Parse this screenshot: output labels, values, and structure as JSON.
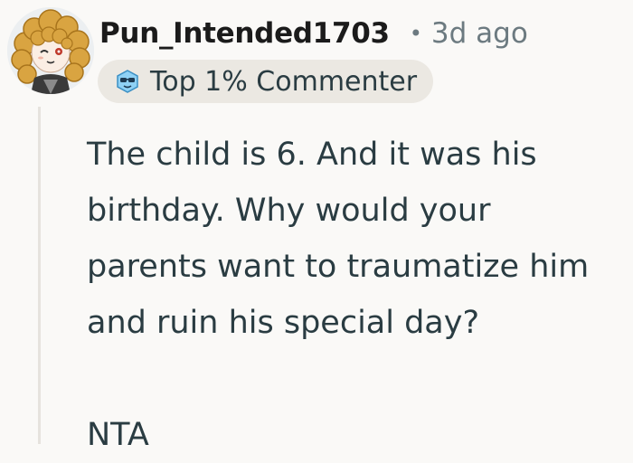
{
  "comment": {
    "username": "Pun_Intended1703",
    "separator": "•",
    "timestamp": "3d ago",
    "badge": {
      "icon": "sunglasses-face-icon",
      "label": "Top 1% Commenter"
    },
    "body_lines": [
      "The child is 6. And it was his",
      "birthday. Why would your",
      "parents want to traumatize him",
      "and ruin his special day?"
    ],
    "verdict": "NTA"
  },
  "colors": {
    "background": "#faf9f7",
    "text": "#2a3c42",
    "muted": "#6c7a80",
    "badge_bg": "#ebe8e2",
    "thread_line": "#e6e3de"
  }
}
